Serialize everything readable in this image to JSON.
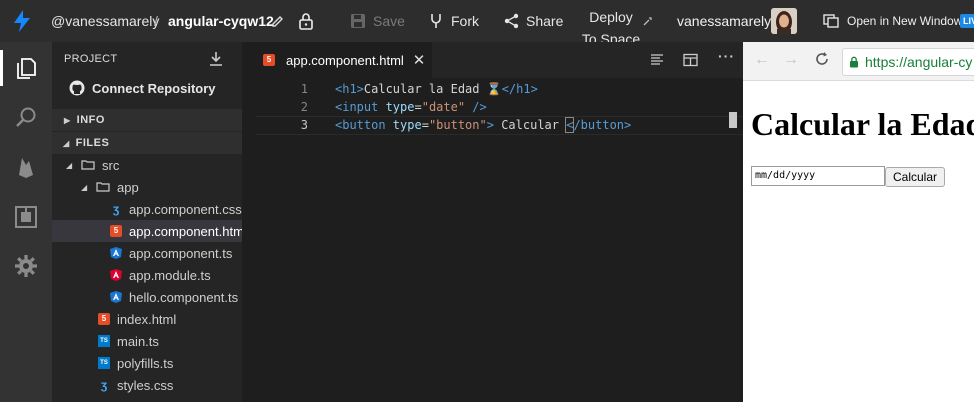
{
  "topbar": {
    "user_handle": "@vanessamarely",
    "separator": "/",
    "project_name": "angular-cyqw12",
    "save_label": "Save",
    "fork_label": "Fork",
    "share_label": "Share",
    "deploy_line1": "Deploy",
    "deploy_line2": "To Space",
    "username": "vanessamarely",
    "open_new_window": "Open in New Window",
    "live_badge": "LIV"
  },
  "sidebar": {
    "project_header": "PROJECT",
    "connect_repo": "Connect Repository",
    "info_section": "INFO",
    "files_section": "FILES",
    "tree": [
      {
        "label": "src"
      },
      {
        "label": "app"
      },
      {
        "label": "app.component.css"
      },
      {
        "label": "app.component.html"
      },
      {
        "label": "app.component.ts"
      },
      {
        "label": "app.module.ts"
      },
      {
        "label": "hello.component.ts"
      },
      {
        "label": "index.html"
      },
      {
        "label": "main.ts"
      },
      {
        "label": "polyfills.ts"
      },
      {
        "label": "styles.css"
      }
    ],
    "icon_texts": {
      "ts": "TS"
    }
  },
  "editor": {
    "tab_label": "app.component.html",
    "lines": [
      {
        "n": "1",
        "p1": "<h1>",
        "t1": "Calcular la Edad ",
        "emoji": "⌛",
        "p2": "</h1>"
      },
      {
        "n": "2",
        "p1": "<input ",
        "a1": "type",
        "eq": "=",
        "s1": "\"date\"",
        "p2": " />"
      },
      {
        "n": "3",
        "p1": "<button ",
        "a1": "type",
        "eq": "=",
        "s1": "\"button\"",
        "p2": ">",
        "t1": " Calcular ",
        "p3": "<",
        "p4": "/button>"
      }
    ]
  },
  "preview": {
    "url": "https://angular-cy",
    "heading": "Calcular la Edad",
    "date_placeholder": "mm/dd/yyyy",
    "button_label": "Calcular"
  },
  "colors": {
    "accent_blue": "#1e88e5",
    "html_icon": "#e44d26",
    "css_icon": "#42a5f5",
    "angular_red": "#dd0031",
    "angular_blue": "#1976d2",
    "ts_icon": "#007acc"
  }
}
